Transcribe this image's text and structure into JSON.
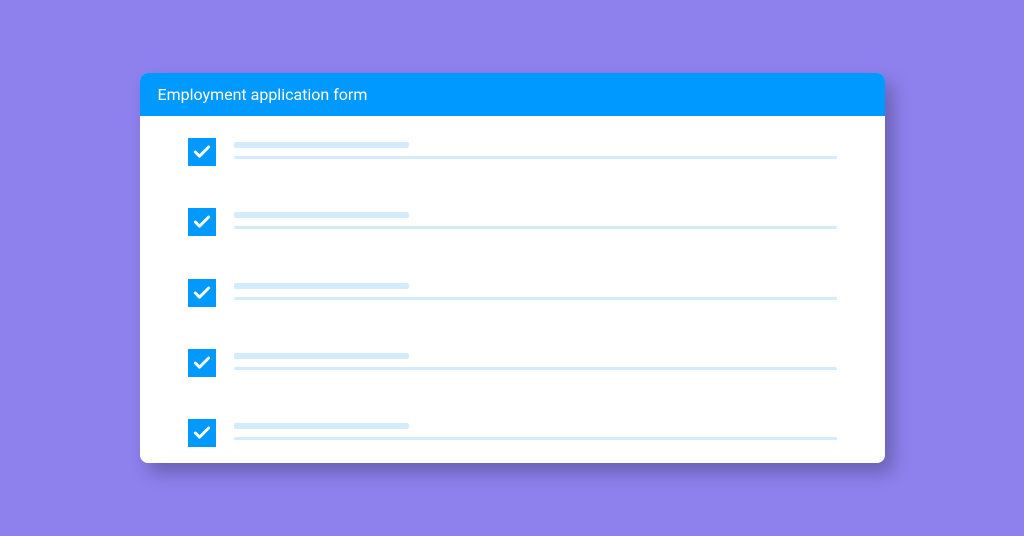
{
  "header": {
    "title": "Employment application form"
  },
  "colors": {
    "background": "#8e81ee",
    "accent": "#0099ff",
    "placeholder": "#d3ecfc",
    "card": "#ffffff"
  },
  "items": [
    {
      "checked": true
    },
    {
      "checked": true
    },
    {
      "checked": true
    },
    {
      "checked": true
    },
    {
      "checked": true
    }
  ]
}
